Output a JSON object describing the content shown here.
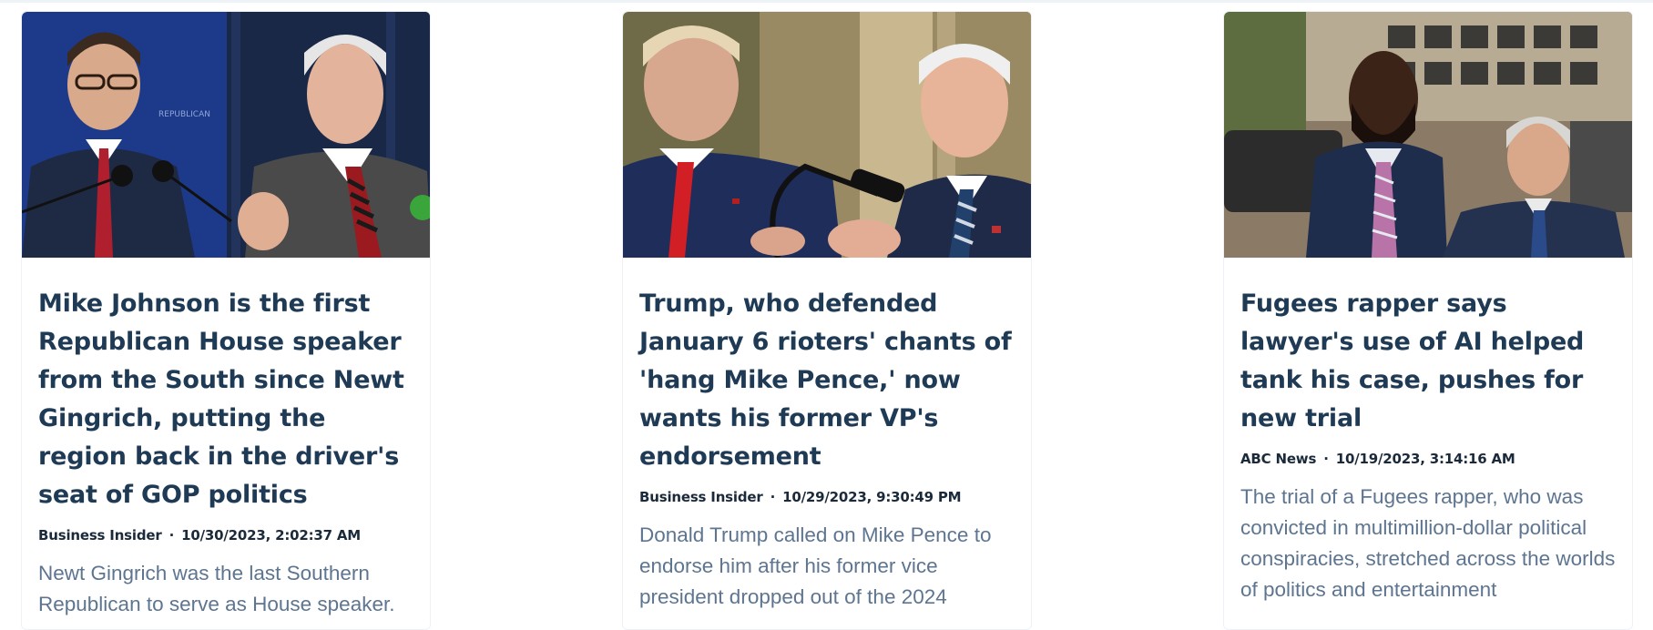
{
  "articles": [
    {
      "title": "Mike Johnson is the first Republican House speaker from the South since Newt Gingrich, putting the region back in the driver's seat of GOP politics",
      "source": "Business Insider",
      "separator": "·",
      "date": "10/30/2023, 2:02:37 AM",
      "description": "Newt Gingrich was the last Southern Republican to serve as House speaker.",
      "image": "two-politicians-speaking-photo"
    },
    {
      "title": "Trump, who defended January 6 rioters' chants of 'hang Mike Pence,' now wants his former VP's endorsement",
      "source": "Business Insider",
      "separator": "·",
      "date": "10/29/2023, 9:30:49 PM",
      "description": "Donald Trump called on Mike Pence to endorse him after his former vice president dropped out of the 2024",
      "image": "trump-and-pence-photo"
    },
    {
      "title": "Fugees rapper says lawyer's use of AI helped tank his case, pushes for new trial",
      "source": "ABC News",
      "separator": "·",
      "date": "10/19/2023, 3:14:16 AM",
      "description": "The trial of a Fugees rapper, who was convicted in multimillion-dollar political conspiracies, stretched across the worlds of politics and entertainment",
      "image": "rapper-and-lawyer-photo"
    }
  ],
  "colors": {
    "headline": "#1f3a55",
    "meta": "#1b2a3a",
    "description": "#5d7590"
  }
}
